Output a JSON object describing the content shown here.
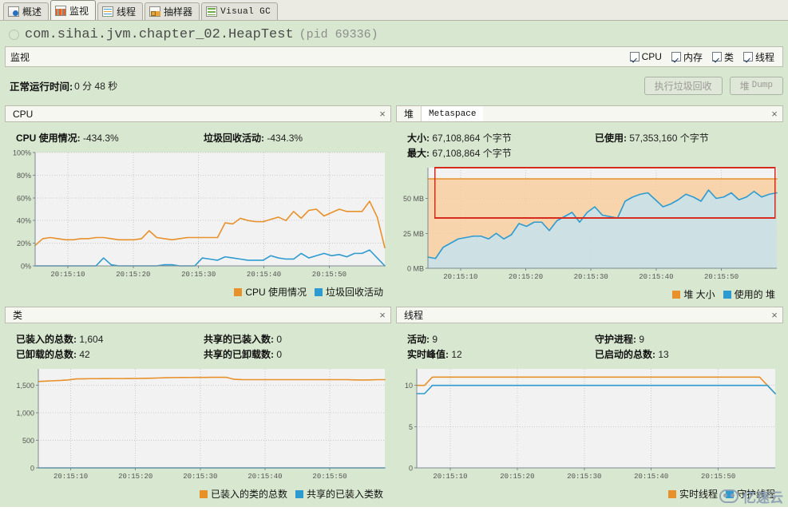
{
  "tabs": [
    {
      "label": "概述",
      "icon": "overview-icon",
      "active": false,
      "mono": false
    },
    {
      "label": "监视",
      "icon": "monitor-icon",
      "active": true,
      "mono": false
    },
    {
      "label": "线程",
      "icon": "threads-icon",
      "active": false,
      "mono": false
    },
    {
      "label": "抽样器",
      "icon": "sampler-icon",
      "active": false,
      "mono": false
    },
    {
      "label": "Visual GC",
      "icon": "visualgc-icon",
      "active": false,
      "mono": true
    }
  ],
  "process": {
    "name": "com.sihai.jvm.chapter_02.HeapTest",
    "pid": "(pid 69336)"
  },
  "monitor_bar": {
    "title": "监视",
    "checkboxes": [
      {
        "label": "CPU",
        "checked": true
      },
      {
        "label": "内存",
        "checked": true
      },
      {
        "label": "类",
        "checked": true
      },
      {
        "label": "线程",
        "checked": true
      }
    ]
  },
  "uptime": {
    "label": "正常运行时间:",
    "value": "0 分 48 秒"
  },
  "buttons": {
    "gc": "执行垃圾回收",
    "heap_dump_cn": "堆",
    "heap_dump_en": "Dump"
  },
  "panels": {
    "cpu": {
      "title": "CPU",
      "close": "×",
      "stats": [
        {
          "label": "CPU 使用情况:",
          "value": "-434.3%"
        },
        {
          "label": "垃圾回收活动:",
          "value": "-434.3%"
        }
      ]
    },
    "heap": {
      "title": "堆",
      "tab": "Metaspace",
      "close": "×",
      "stats": [
        {
          "label": "大小:",
          "value": "67,108,864 个字节"
        },
        {
          "label": "已使用:",
          "value": "57,353,160 个字节"
        },
        {
          "label": "最大:",
          "value": "67,108,864 个字节"
        }
      ]
    },
    "classes": {
      "title": "类",
      "close": "×",
      "stats": [
        {
          "label": "已装入的总数:",
          "value": "1,604"
        },
        {
          "label": "共享的已装入数:",
          "value": "0"
        },
        {
          "label": "已卸载的总数:",
          "value": "42"
        },
        {
          "label": "共享的已卸载数:",
          "value": "0"
        }
      ]
    },
    "threads": {
      "title": "线程",
      "close": "×",
      "stats": [
        {
          "label": "活动:",
          "value": "9"
        },
        {
          "label": "守护进程:",
          "value": "9"
        },
        {
          "label": "实时峰值:",
          "value": "12"
        },
        {
          "label": "已启动的总数:",
          "value": "13"
        }
      ]
    }
  },
  "watermark": {
    "text": "亿速云"
  },
  "colors": {
    "orange": "#e8912a",
    "blue": "#2e9bd0",
    "orange_fill": "#f8cfa0",
    "blue_fill": "#bfe4f6",
    "selection": "#d62b1f",
    "panel_bg": "#d8e7cf",
    "plot_bg": "#f2f2f2"
  },
  "chart_data": [
    {
      "id": "cpu",
      "type": "line",
      "title": "CPU",
      "xlabel": "",
      "ylabel": "",
      "grid": true,
      "legend_position": "bottom-right",
      "xtick_labels": [
        "20:15:10",
        "20:15:20",
        "20:15:30",
        "20:15:40",
        "20:15:50"
      ],
      "ytick_labels": [
        "0%",
        "20%",
        "40%",
        "60%",
        "80%",
        "100%"
      ],
      "ylim": [
        0,
        100
      ],
      "yticks": [
        0,
        20,
        40,
        60,
        80,
        100
      ],
      "series": [
        {
          "name": "CPU 使用情况",
          "color": "#e8912a",
          "values": [
            18,
            24,
            25,
            24,
            23,
            23,
            24,
            24,
            25,
            25,
            24,
            23,
            23,
            23,
            24,
            31,
            25,
            24,
            23,
            24,
            25,
            25,
            25,
            25,
            25,
            38,
            37,
            42,
            40,
            39,
            39,
            41,
            43,
            40,
            48,
            42,
            49,
            50,
            44,
            47,
            50,
            48,
            48,
            48,
            57,
            43,
            16
          ]
        },
        {
          "name": "垃圾回收活动",
          "color": "#2e9bd0",
          "values": [
            0,
            0,
            0,
            0,
            0,
            0,
            0,
            0,
            0,
            7,
            1,
            0,
            0,
            0,
            0,
            0,
            0,
            1,
            1,
            0,
            0,
            0,
            7,
            6,
            5,
            8,
            7,
            6,
            5,
            5,
            5,
            9,
            7,
            6,
            6,
            11,
            7,
            9,
            11,
            9,
            10,
            8,
            11,
            11,
            14,
            7,
            0
          ]
        }
      ]
    },
    {
      "id": "heap",
      "type": "area",
      "title": "堆",
      "xlabel": "",
      "ylabel": "",
      "grid": true,
      "legend_position": "bottom-right",
      "xtick_labels": [
        "20:15:10",
        "20:15:20",
        "20:15:30",
        "20:15:40",
        "20:15:50"
      ],
      "ytick_labels": [
        "0 MB",
        "25 MB",
        "50 MB"
      ],
      "ylim": [
        0,
        72
      ],
      "yticks": [
        0,
        25,
        50
      ],
      "selection_box": {
        "x0_frac": 0.02,
        "x1_frac": 0.995,
        "y0_mb": 72,
        "y1_mb": 36
      },
      "series": [
        {
          "name": "堆 大小",
          "color": "#e8912a",
          "fill": "#f8cfa0",
          "values": [
            64,
            64,
            64,
            64,
            64,
            64,
            64,
            64,
            64,
            64,
            64,
            64,
            64,
            64,
            64,
            64,
            64,
            64,
            64,
            64,
            64,
            64,
            64,
            64,
            64,
            64,
            64,
            64,
            64,
            64,
            64,
            64,
            64,
            64,
            64,
            64,
            64,
            64,
            64,
            64,
            64,
            64,
            64,
            64,
            64,
            64,
            64
          ]
        },
        {
          "name": "使用的 堆",
          "color": "#2e9bd0",
          "fill": "#bfe4f6",
          "values": [
            8,
            7,
            15,
            18,
            21,
            22,
            23,
            23,
            21,
            25,
            21,
            24,
            32,
            30,
            33,
            33,
            27,
            34,
            37,
            40,
            33,
            40,
            44,
            38,
            37,
            36,
            48,
            51,
            53,
            54,
            49,
            44,
            46,
            49,
            53,
            51,
            48,
            56,
            50,
            51,
            54,
            49,
            51,
            55,
            51,
            53,
            54
          ]
        }
      ]
    },
    {
      "id": "classes",
      "type": "line",
      "title": "类",
      "xlabel": "",
      "ylabel": "",
      "grid": true,
      "legend_position": "bottom-right",
      "xtick_labels": [
        "20:15:10",
        "20:15:20",
        "20:15:30",
        "20:15:40",
        "20:15:50"
      ],
      "ytick_labels": [
        "0",
        "500",
        "1,000",
        "1,500"
      ],
      "ylim": [
        0,
        1800
      ],
      "yticks": [
        0,
        500,
        1000,
        1500
      ],
      "series": [
        {
          "name": "已装入的类的总数",
          "color": "#e8912a",
          "values": [
            1570,
            1578,
            1584,
            1590,
            1600,
            1618,
            1620,
            1622,
            1622,
            1623,
            1624,
            1624,
            1625,
            1626,
            1628,
            1630,
            1635,
            1640,
            1642,
            1643,
            1644,
            1645,
            1645,
            1646,
            1646,
            1646,
            1610,
            1605,
            1604,
            1604,
            1604,
            1604,
            1604,
            1604,
            1604,
            1604,
            1604,
            1604,
            1604,
            1604,
            1604,
            1604,
            1600,
            1598,
            1600,
            1604,
            1604
          ]
        },
        {
          "name": "共享的已装入类数",
          "color": "#2e9bd0",
          "values": [
            0,
            0,
            0,
            0,
            0,
            0,
            0,
            0,
            0,
            0,
            0,
            0,
            0,
            0,
            0,
            0,
            0,
            0,
            0,
            0,
            0,
            0,
            0,
            0,
            0,
            0,
            0,
            0,
            0,
            0,
            0,
            0,
            0,
            0,
            0,
            0,
            0,
            0,
            0,
            0,
            0,
            0,
            0,
            0,
            0,
            0,
            0
          ]
        }
      ]
    },
    {
      "id": "threads",
      "type": "line",
      "title": "线程",
      "xlabel": "",
      "ylabel": "",
      "grid": true,
      "legend_position": "bottom-right",
      "xtick_labels": [
        "20:15:10",
        "20:15:20",
        "20:15:30",
        "20:15:40",
        "20:15:50"
      ],
      "ytick_labels": [
        "0",
        "5",
        "10"
      ],
      "ylim": [
        0,
        12
      ],
      "yticks": [
        0,
        5,
        10
      ],
      "series": [
        {
          "name": "实时线程",
          "color": "#e8912a",
          "values": [
            10,
            10,
            11,
            11,
            11,
            11,
            11,
            11,
            11,
            11,
            11,
            11,
            11,
            11,
            11,
            11,
            11,
            11,
            11,
            11,
            11,
            11,
            11,
            11,
            11,
            11,
            11,
            11,
            11,
            11,
            11,
            11,
            11,
            11,
            11,
            11,
            11,
            11,
            11,
            11,
            11,
            11,
            11,
            11,
            11,
            10,
            9
          ]
        },
        {
          "name": "守护线程",
          "color": "#2e9bd0",
          "values": [
            9,
            9,
            10,
            10,
            10,
            10,
            10,
            10,
            10,
            10,
            10,
            10,
            10,
            10,
            10,
            10,
            10,
            10,
            10,
            10,
            10,
            10,
            10,
            10,
            10,
            10,
            10,
            10,
            10,
            10,
            10,
            10,
            10,
            10,
            10,
            10,
            10,
            10,
            10,
            10,
            10,
            10,
            10,
            10,
            10,
            10,
            9
          ]
        }
      ]
    }
  ]
}
